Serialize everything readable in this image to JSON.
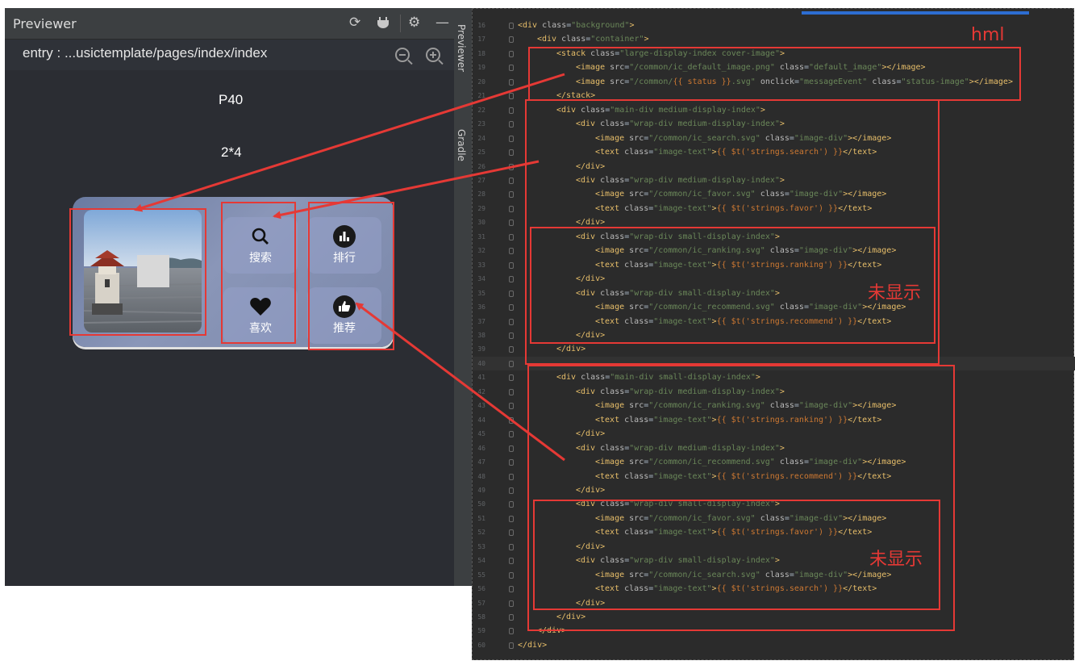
{
  "previewer": {
    "title": "Previewer",
    "path": "entry : ...usictemplate/pages/index/index",
    "device": "P40",
    "grid": "2*4",
    "tools": {
      "refresh": "⟳",
      "settings": "⚙",
      "minimize": "—"
    },
    "tiles": [
      {
        "label": "搜索",
        "icon": "search-icon"
      },
      {
        "label": "排行",
        "icon": "ranking-icon"
      },
      {
        "label": "喜欢",
        "icon": "heart-icon"
      },
      {
        "label": "推荐",
        "icon": "thumbs-up-icon"
      }
    ],
    "side_tabs": [
      "Previewer",
      "Gradle"
    ]
  },
  "editor": {
    "lines": [
      {
        "n": "16",
        "indent": 0,
        "html": "<div class=\"background\">"
      },
      {
        "n": "17",
        "indent": 1,
        "html": "<div class=\"container\">"
      },
      {
        "n": "18",
        "indent": 2,
        "html": "<stack class=\"large-display-index cover-image\">"
      },
      {
        "n": "19",
        "indent": 3,
        "html": "<image src=\"/common/ic_default_image.png\" class=\"default_image\"></image>"
      },
      {
        "n": "20",
        "indent": 3,
        "html": "<image src=\"/common/{{ status }}.svg\" onclick=\"messageEvent\" class=\"status-image\"></image>"
      },
      {
        "n": "21",
        "indent": 2,
        "html": "</stack>"
      },
      {
        "n": "22",
        "indent": 2,
        "html": "<div class=\"main-div medium-display-index\">"
      },
      {
        "n": "23",
        "indent": 3,
        "html": "<div class=\"wrap-div medium-display-index\">"
      },
      {
        "n": "24",
        "indent": 4,
        "html": "<image src=\"/common/ic_search.svg\" class=\"image-div\"></image>"
      },
      {
        "n": "25",
        "indent": 4,
        "html": "<text class=\"image-text\">{{ $t('strings.search') }}</text>"
      },
      {
        "n": "26",
        "indent": 3,
        "html": "</div>"
      },
      {
        "n": "27",
        "indent": 3,
        "html": "<div class=\"wrap-div medium-display-index\">"
      },
      {
        "n": "28",
        "indent": 4,
        "html": "<image src=\"/common/ic_favor.svg\" class=\"image-div\"></image>"
      },
      {
        "n": "29",
        "indent": 4,
        "html": "<text class=\"image-text\">{{ $t('strings.favor') }}</text>"
      },
      {
        "n": "30",
        "indent": 3,
        "html": "</div>"
      },
      {
        "n": "31",
        "indent": 3,
        "html": "<div class=\"wrap-div small-display-index\">"
      },
      {
        "n": "32",
        "indent": 4,
        "html": "<image src=\"/common/ic_ranking.svg\" class=\"image-div\"></image>"
      },
      {
        "n": "33",
        "indent": 4,
        "html": "<text class=\"image-text\">{{ $t('strings.ranking') }}</text>"
      },
      {
        "n": "34",
        "indent": 3,
        "html": "</div>"
      },
      {
        "n": "35",
        "indent": 3,
        "html": "<div class=\"wrap-div small-display-index\">"
      },
      {
        "n": "36",
        "indent": 4,
        "html": "<image src=\"/common/ic_recommend.svg\" class=\"image-div\"></image>"
      },
      {
        "n": "37",
        "indent": 4,
        "html": "<text class=\"image-text\">{{ $t('strings.recommend') }}</text>"
      },
      {
        "n": "38",
        "indent": 3,
        "html": "</div>"
      },
      {
        "n": "39",
        "indent": 2,
        "html": "</div>"
      },
      {
        "n": "40",
        "indent": 0,
        "html": ""
      },
      {
        "n": "41",
        "indent": 2,
        "html": "<div class=\"main-div small-display-index\">"
      },
      {
        "n": "42",
        "indent": 3,
        "html": "<div class=\"wrap-div medium-display-index\">"
      },
      {
        "n": "43",
        "indent": 4,
        "html": "<image src=\"/common/ic_ranking.svg\" class=\"image-div\"></image>"
      },
      {
        "n": "44",
        "indent": 4,
        "html": "<text class=\"image-text\">{{ $t('strings.ranking') }}</text>"
      },
      {
        "n": "45",
        "indent": 3,
        "html": "</div>"
      },
      {
        "n": "46",
        "indent": 3,
        "html": "<div class=\"wrap-div medium-display-index\">"
      },
      {
        "n": "47",
        "indent": 4,
        "html": "<image src=\"/common/ic_recommend.svg\" class=\"image-div\"></image>"
      },
      {
        "n": "48",
        "indent": 4,
        "html": "<text class=\"image-text\">{{ $t('strings.recommend') }}</text>"
      },
      {
        "n": "49",
        "indent": 3,
        "html": "</div>"
      },
      {
        "n": "50",
        "indent": 3,
        "html": "<div class=\"wrap-div small-display-index\">"
      },
      {
        "n": "51",
        "indent": 4,
        "html": "<image src=\"/common/ic_favor.svg\" class=\"image-div\"></image>"
      },
      {
        "n": "52",
        "indent": 4,
        "html": "<text class=\"image-text\">{{ $t('strings.favor') }}</text>"
      },
      {
        "n": "53",
        "indent": 3,
        "html": "</div>"
      },
      {
        "n": "54",
        "indent": 3,
        "html": "<div class=\"wrap-div small-display-index\">"
      },
      {
        "n": "55",
        "indent": 4,
        "html": "<image src=\"/common/ic_search.svg\" class=\"image-div\"></image>"
      },
      {
        "n": "56",
        "indent": 4,
        "html": "<text class=\"image-text\">{{ $t('strings.search') }}</text>"
      },
      {
        "n": "57",
        "indent": 3,
        "html": "</div>"
      },
      {
        "n": "58",
        "indent": 2,
        "html": "</div>"
      },
      {
        "n": "59",
        "indent": 1,
        "html": "</div>"
      },
      {
        "n": "60",
        "indent": 0,
        "html": "</div>"
      }
    ]
  },
  "annotations": {
    "hml": "hml",
    "not_shown_1": "未显示",
    "not_shown_2": "未显示"
  },
  "colors": {
    "annotation_red": "#e53935",
    "accent_blue": "#2d6dd2"
  }
}
